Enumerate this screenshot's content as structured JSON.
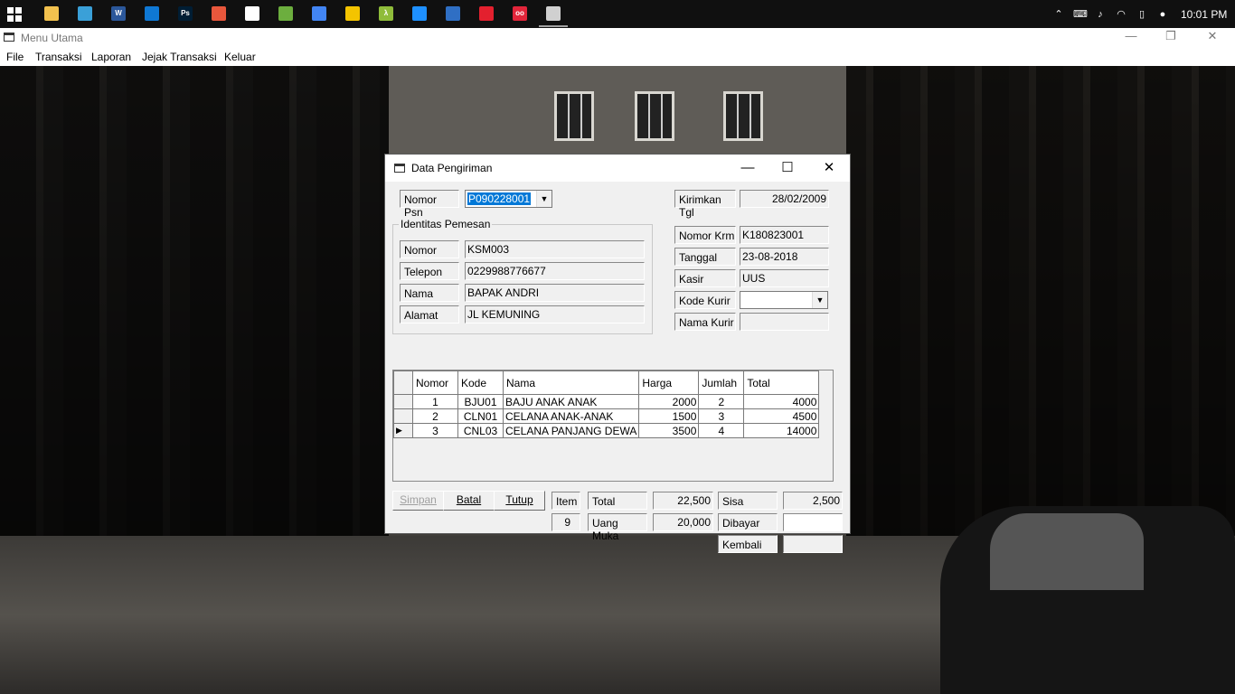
{
  "taskbar": {
    "apps": [
      {
        "icon": "file-explorer-icon",
        "color": "#f2c14e"
      },
      {
        "icon": "search-app-icon",
        "color": "#3aa0d8"
      },
      {
        "icon": "word-icon",
        "color": "#2b579a",
        "glyph": "W"
      },
      {
        "icon": "outlook-icon",
        "color": "#0f78d4"
      },
      {
        "icon": "photoshop-icon",
        "color": "#001d34",
        "glyph": "Ps"
      },
      {
        "icon": "paint-icon",
        "color": "#e8573c"
      },
      {
        "icon": "media-icon",
        "color": "#ffffff"
      },
      {
        "icon": "spreadsheet-icon",
        "color": "#6cae3e"
      },
      {
        "icon": "chrome-icon",
        "color": "#4285f4"
      },
      {
        "icon": "notes-icon",
        "color": "#f4c400"
      },
      {
        "icon": "lambda-icon",
        "color": "#8fbc3a",
        "glyph": "λ"
      },
      {
        "icon": "shield-app-icon",
        "color": "#1e90ff"
      },
      {
        "icon": "network-app-icon",
        "color": "#2f6fc4"
      },
      {
        "icon": "opera-icon",
        "color": "#e3202e"
      },
      {
        "icon": "remote-app-icon",
        "color": "#e2253a",
        "glyph": "oo"
      },
      {
        "icon": "vb-app-icon",
        "color": "#d0d0d0"
      }
    ],
    "clock": "10:01 PM"
  },
  "main_window": {
    "title": "Menu Utama",
    "menu": [
      "File",
      "Transaksi",
      "Laporan",
      "Jejak Transaksi",
      "Keluar"
    ]
  },
  "dialog": {
    "title": "Data Pengiriman",
    "nomor_psn_label": "Nomor Psn",
    "nomor_psn_value": "P090228001",
    "kirimkan_tgl_label": "Kirimkan Tgl",
    "kirimkan_tgl_value": "28/02/2009",
    "group_title": "Identitas Pemesan",
    "pemesan": [
      {
        "label": "Nomor",
        "value": "KSM003"
      },
      {
        "label": "Telepon",
        "value": "0229988776677"
      },
      {
        "label": "Nama",
        "value": "BAPAK ANDRI"
      },
      {
        "label": "Alamat",
        "value": "JL KEMUNING"
      }
    ],
    "kirim": [
      {
        "label": "Nomor Krm",
        "value": "K180823001"
      },
      {
        "label": "Tanggal",
        "value": "23-08-2018"
      },
      {
        "label": "Kasir",
        "value": "UUS"
      }
    ],
    "kode_kurir_label": "Kode Kurir",
    "kode_kurir_value": "",
    "nama_kurir_label": "Nama Kurir",
    "nama_kurir_value": "",
    "grid": {
      "columns": [
        "Nomor",
        "Kode",
        "Nama",
        "Harga",
        "Jumlah",
        "Total"
      ],
      "rows": [
        {
          "nomor": "1",
          "kode": "BJU01",
          "nama": "BAJU ANAK ANAK",
          "harga": "2000",
          "jumlah": "2",
          "total": "4000"
        },
        {
          "nomor": "2",
          "kode": "CLN01",
          "nama": "CELANA ANAK-ANAK",
          "harga": "1500",
          "jumlah": "3",
          "total": "4500"
        },
        {
          "nomor": "3",
          "kode": "CNL03",
          "nama": "CELANA PANJANG DEWA",
          "harga": "3500",
          "jumlah": "4",
          "total": "14000"
        }
      ],
      "current_row_marker": "▶"
    },
    "buttons": {
      "simpan": "Simpan",
      "batal": "Batal",
      "tutup": "Tutup"
    },
    "summary": {
      "item_label": "Item",
      "item_value": "9",
      "total_label": "Total",
      "total_value": "22,500",
      "uang_muka_label": "Uang Muka",
      "uang_muka_value": "20,000",
      "sisa_label": "Sisa",
      "sisa_value": "2,500",
      "dibayar_label": "Dibayar",
      "dibayar_value": "",
      "kembali_label": "Kembali",
      "kembali_value": ""
    }
  }
}
